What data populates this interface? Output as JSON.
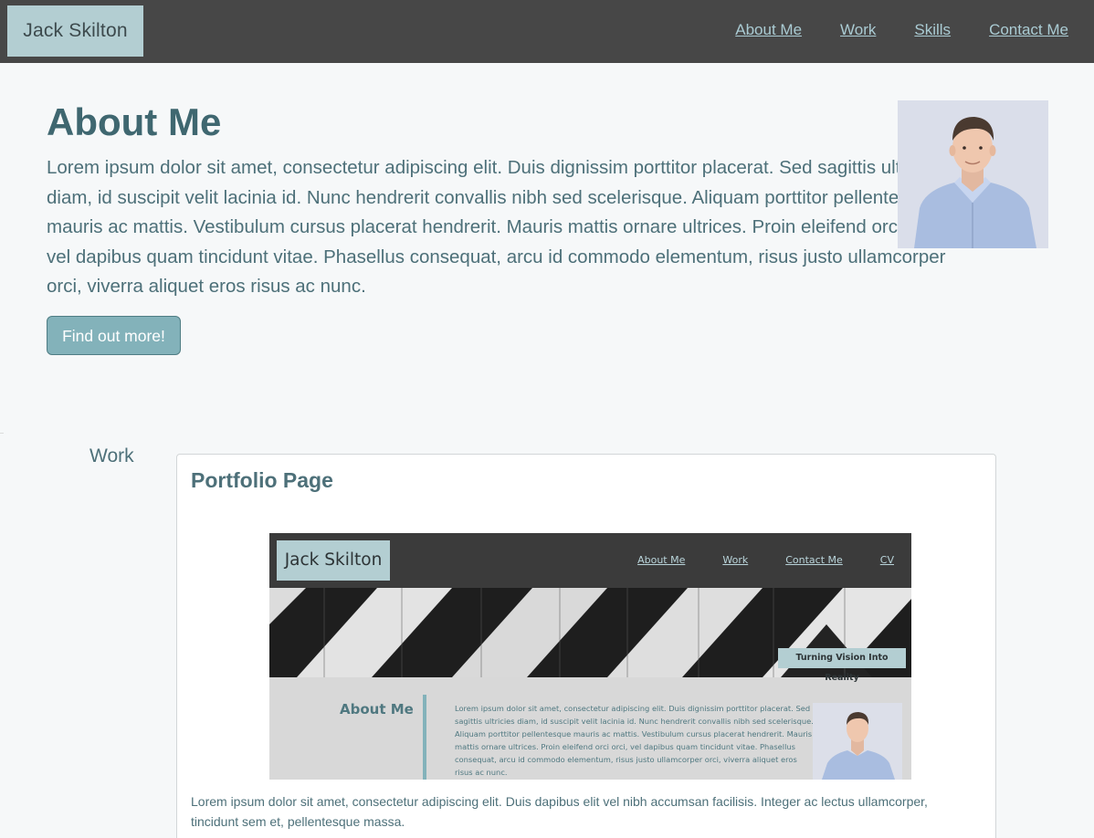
{
  "header": {
    "brand": "Jack Skilton",
    "nav": [
      "About Me",
      "Work",
      "Skills",
      "Contact Me"
    ]
  },
  "about": {
    "title": "About Me",
    "text": "Lorem ipsum dolor sit amet, consectetur adipiscing elit. Duis dignissim porttitor placerat. Sed sagittis ultricies diam, id suscipit velit lacinia id. Nunc hendrerit convallis nibh sed scelerisque. Aliquam porttitor pellentesque mauris ac mattis. Vestibulum cursus placerat hendrerit. Mauris mattis ornare ultrices. Proin eleifend orci orci, vel dapibus quam tincidunt vitae. Phasellus consequat, arcu id commodo elementum, risus justo ullamcorper orci, viverra aliquet eros risus ac nunc.",
    "button": "Find out more!"
  },
  "work": {
    "label": "Work",
    "card": {
      "title": "Portfolio Page",
      "description": "Lorem ipsum dolor sit amet, consectetur adipiscing elit. Duis dapibus elit vel nibh accumsan facilisis. Integer ac lectus ullamcorper, tincidunt sem et, pellentesque massa.",
      "preview": {
        "brand": "Jack Skilton",
        "nav": [
          "About Me",
          "Work",
          "Contact Me",
          "CV"
        ],
        "tagline": "Turning Vision Into Reality",
        "about_title": "About Me",
        "about_text": "Lorem ipsum dolor sit amet, consectetur adipiscing elit. Duis dignissim porttitor placerat. Sed sagittis ultricies diam, id suscipit velit lacinia id. Nunc hendrerit convallis nibh sed scelerisque. Aliquam porttitor pellentesque mauris ac mattis. Vestibulum cursus placerat hendrerit. Mauris mattis ornare ultrices. Proin eleifend orci orci, vel dapibus quam tincidunt vitae. Phasellus consequat, arcu id commodo elementum, risus justo ullamcorper orci, viverra aliquet eros risus ac nunc."
      }
    }
  },
  "colors": {
    "header_bg": "#474747",
    "brand_bg": "#b3ced2",
    "accent": "#83b2ba",
    "text": "#3f6770"
  }
}
